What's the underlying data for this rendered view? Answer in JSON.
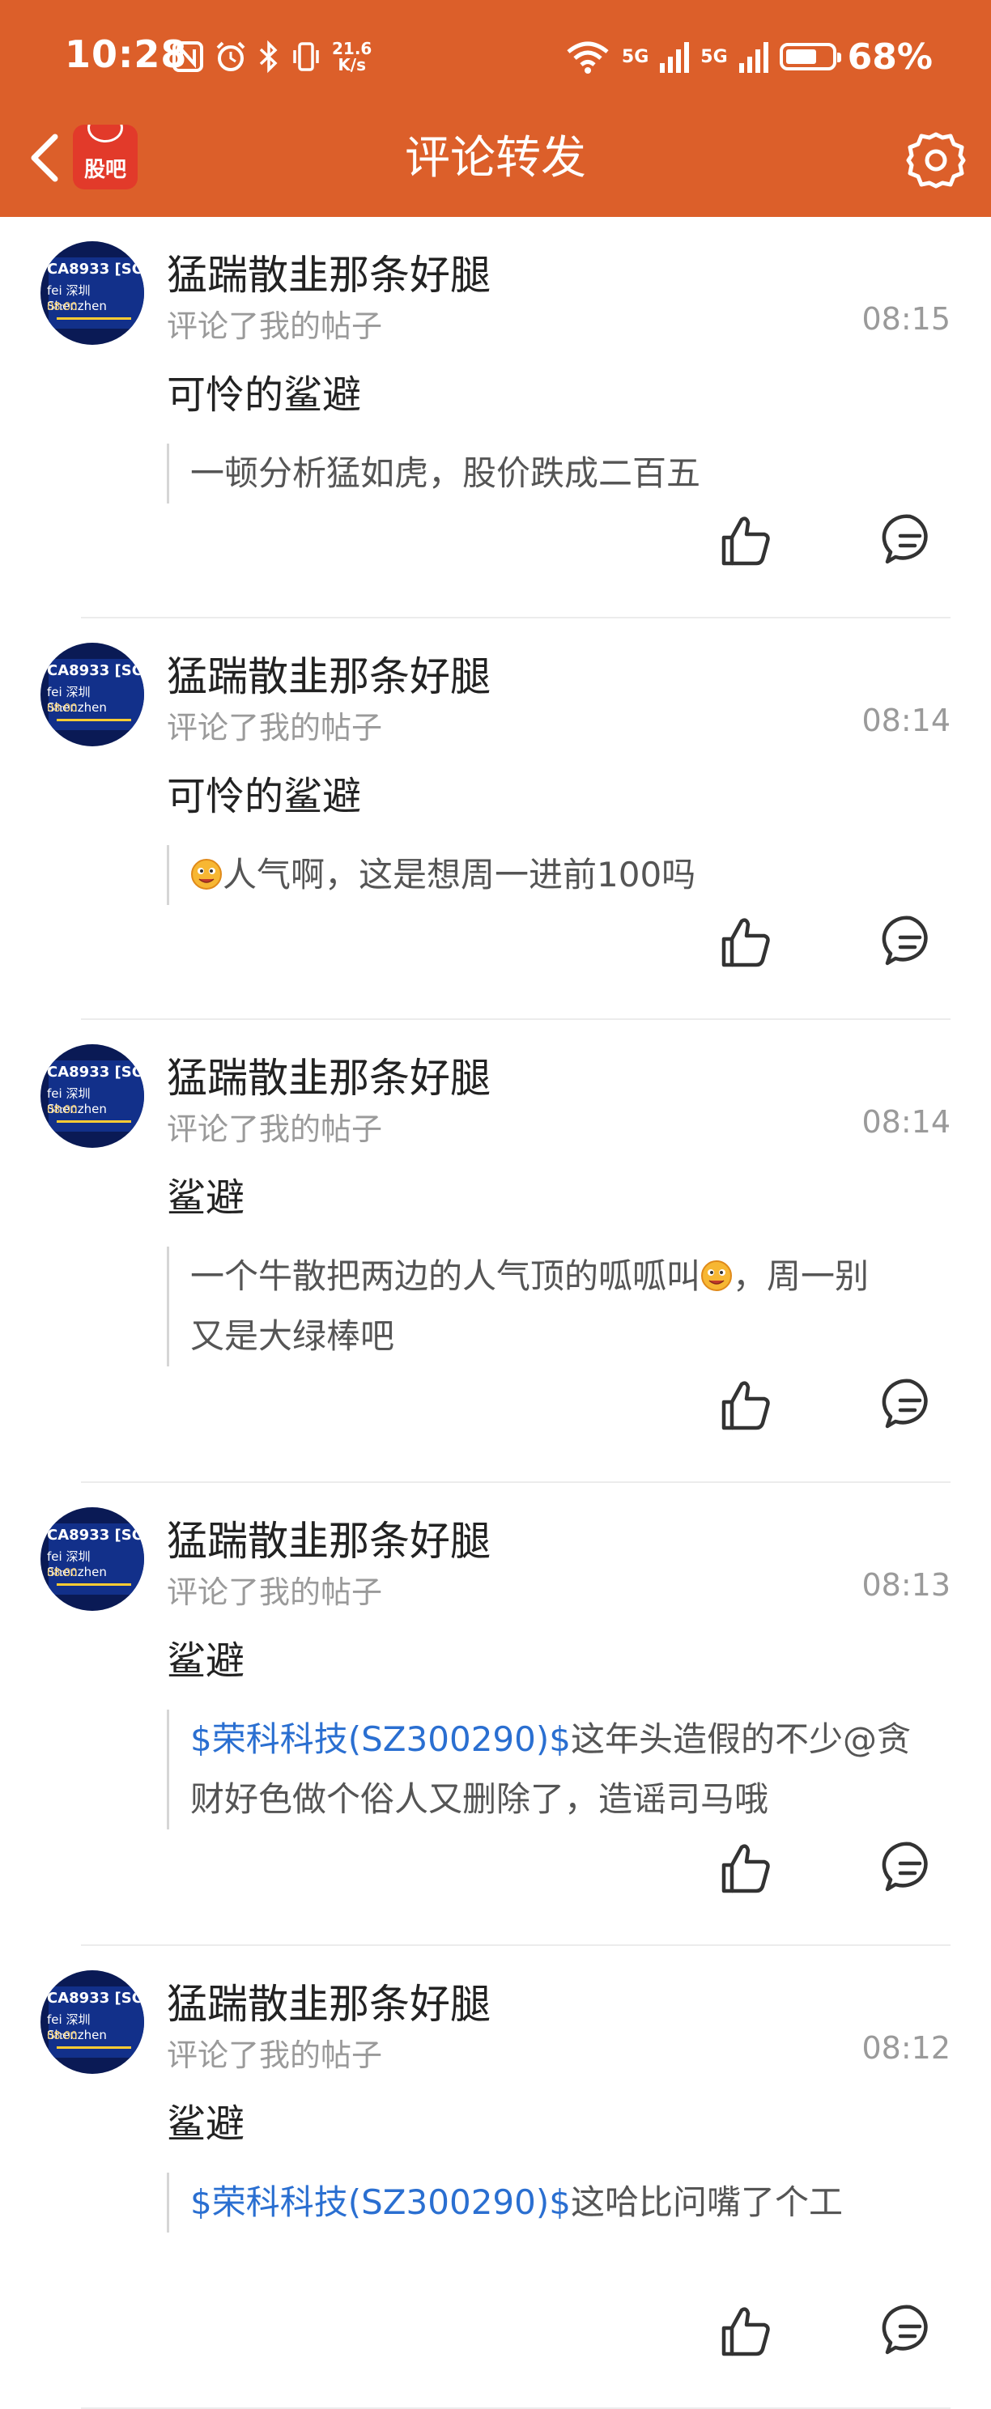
{
  "status_bar": {
    "time": "10:28",
    "net_speed_value": "21.6",
    "net_speed_unit": "K/s",
    "signal_1": "5G",
    "signal_2": "5G",
    "battery_percent": "68%",
    "battery_level": 0.68
  },
  "header": {
    "title": "评论转发",
    "logo_text": "股吧",
    "icons": [
      "back-icon",
      "guba-logo",
      "settings-icon"
    ]
  },
  "colors": {
    "header_bg": "#dc5f2a",
    "stock_link": "#2a6fd1",
    "muted_text": "#9a9a9a"
  },
  "avatar_text": {
    "line1": "CA8933 [SC",
    "line2": "fei 深圳Shenzhen",
    "line3": "08:00"
  },
  "feed": [
    {
      "username": "猛踹散韭那条好腿",
      "action": "评论了我的帖子",
      "time": "08:15",
      "target": "可怜的鲨避",
      "quote_lines": [
        [
          {
            "t": "text",
            "v": "一顿分析猛如虎，股价跌成二百五"
          }
        ]
      ]
    },
    {
      "username": "猛踹散韭那条好腿",
      "action": "评论了我的帖子",
      "time": "08:14",
      "target": "可怜的鲨避",
      "quote_lines": [
        [
          {
            "t": "emoji",
            "v": "smile-emoji"
          },
          {
            "t": "text",
            "v": "人气啊，这是想周一进前100吗"
          }
        ]
      ]
    },
    {
      "username": "猛踹散韭那条好腿",
      "action": "评论了我的帖子",
      "time": "08:14",
      "target": "鲨避",
      "quote_lines": [
        [
          {
            "t": "text",
            "v": "一个牛散把两边的人气顶的呱呱叫"
          },
          {
            "t": "emoji",
            "v": "smile-emoji"
          },
          {
            "t": "text",
            "v": "，周一别"
          }
        ],
        [
          {
            "t": "text",
            "v": "又是大绿棒吧"
          }
        ]
      ]
    },
    {
      "username": "猛踹散韭那条好腿",
      "action": "评论了我的帖子",
      "time": "08:13",
      "target": "鲨避",
      "quote_lines": [
        [
          {
            "t": "stock",
            "v": "$荣科科技(SZ300290)$"
          },
          {
            "t": "text",
            "v": "这年头造假的不少@贪"
          }
        ],
        [
          {
            "t": "text",
            "v": "财好色做个俗人又删除了，造谣司马哦"
          }
        ]
      ]
    },
    {
      "username": "猛踹散韭那条好腿",
      "action": "评论了我的帖子",
      "time": "08:12",
      "target": "鲨避",
      "quote_lines": [
        [
          {
            "t": "stock",
            "v": "$荣科科技(SZ300290)$"
          },
          {
            "t": "text",
            "v": "这哈比问嘴了个工"
          }
        ]
      ]
    }
  ]
}
